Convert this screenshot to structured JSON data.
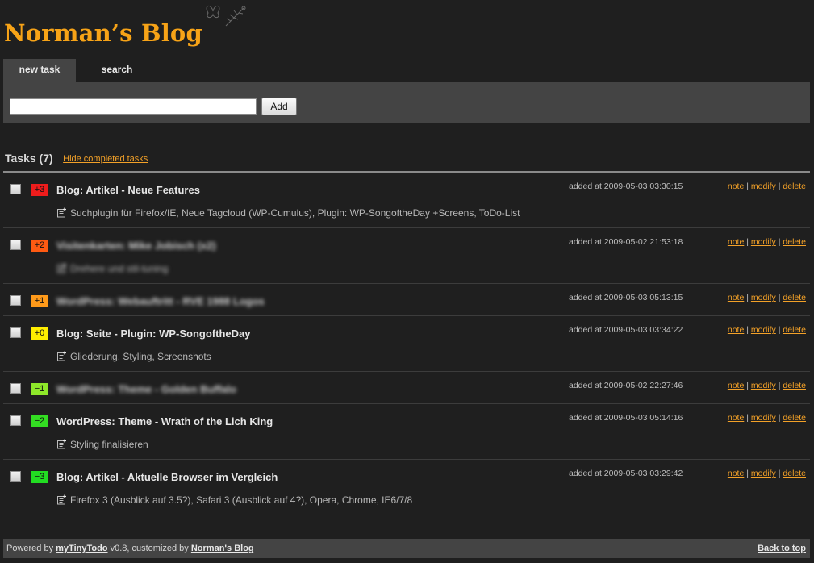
{
  "header": {
    "logo_text": "Norman’s Blog"
  },
  "tabs": [
    {
      "label": "new task",
      "active": true
    },
    {
      "label": "search",
      "active": false
    }
  ],
  "newtask": {
    "input_value": "",
    "add_label": "Add"
  },
  "tasks_header": {
    "title": "Tasks (7)",
    "hide_completed": "Hide completed tasks"
  },
  "action_labels": {
    "note": "note",
    "modify": "modify",
    "delete": "delete",
    "sep": "|"
  },
  "tasks": [
    {
      "priority": "+3",
      "priority_color": "#ee1c1c",
      "title": "Blog: Artikel - Neue Features",
      "blurred": false,
      "note": "Suchplugin für Firefox/IE, Neue Tagcloud (WP-Cumulus), Plugin: WP-SongoftheDay +Screens, ToDo-List",
      "added": "added at 2009-05-03 03:30:15"
    },
    {
      "priority": "+2",
      "priority_color": "#ff5a12",
      "title": "Visitenkarten: Mike Jobisch (x2)",
      "blurred": true,
      "note": "Drehere und stil-tuning",
      "added": "added at 2009-05-02 21:53:18"
    },
    {
      "priority": "+1",
      "priority_color": "#ff9a1a",
      "title": "WordPress: Webauftritt - RVE 1988 Logos",
      "blurred": true,
      "note": null,
      "added": "added at 2009-05-03 05:13:15"
    },
    {
      "priority": "+0",
      "priority_color": "#ffee00",
      "title": "Blog: Seite - Plugin: WP-SongoftheDay",
      "blurred": false,
      "note": "Gliederung, Styling, Screenshots",
      "added": "added at 2009-05-03 03:34:22"
    },
    {
      "priority": "−1",
      "priority_color": "#8ee82a",
      "title": "WordPress: Theme - Golden Buffalo",
      "blurred": true,
      "note": null,
      "added": "added at 2009-05-02 22:27:46"
    },
    {
      "priority": "−2",
      "priority_color": "#33dd22",
      "title": "WordPress: Theme - Wrath of the Lich King",
      "blurred": false,
      "note": "Styling finalisieren",
      "added": "added at 2009-05-03 05:14:16"
    },
    {
      "priority": "−3",
      "priority_color": "#22dd22",
      "title": "Blog: Artikel - Aktuelle Browser im Vergleich",
      "blurred": false,
      "note": "Firefox 3 (Ausblick auf 3.5?), Safari 3 (Ausblick auf 4?), Opera, Chrome, IE6/7/8",
      "added": "added at 2009-05-03 03:29:42"
    }
  ],
  "footer": {
    "powered_by": "Powered by ",
    "app_name": "myTinyTodo",
    "version_text": " v0.8, customized by ",
    "blog_name": "Norman's Blog",
    "back_to_top": "Back to top"
  }
}
